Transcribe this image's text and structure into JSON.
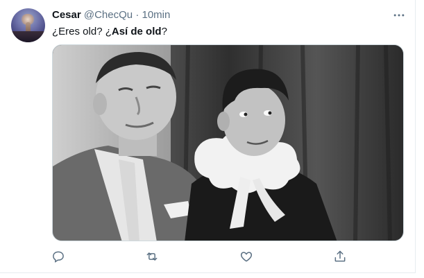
{
  "tweet": {
    "author_name": "Cesar",
    "author_handle": "@ChecQu",
    "separator": "·",
    "time": "10min",
    "text_before": "¿Eres old? ¿",
    "text_bold": "Así de old",
    "text_after": "?",
    "more_icon": "more-horizontal-icon",
    "colors": {
      "secondary": "#5b7083",
      "primary_text": "#0f1419",
      "border": "#cfd9de"
    }
  },
  "actions": [
    {
      "name": "reply",
      "icon": "reply-icon"
    },
    {
      "name": "retweet",
      "icon": "retweet-icon"
    },
    {
      "name": "like",
      "icon": "heart-icon"
    },
    {
      "name": "share",
      "icon": "share-icon"
    }
  ]
}
